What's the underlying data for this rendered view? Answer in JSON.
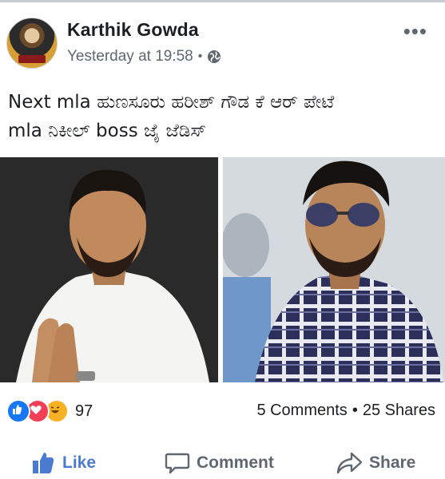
{
  "post": {
    "author": "Karthik Gowda",
    "timestamp": "Yesterday at 19:58",
    "separator": "•",
    "privacy_icon": "globe-icon",
    "more_label": "•••",
    "text_line1": "Next mla ಹುಣಸೂರು ಹರೀಶ್ ಗೌಡ   ಕೆ ಆರ್ ಪೇಟೆ",
    "text_line2": "mla ನಿಕೀಲ್ boss ಜೈ ಜೆಡಿಸ್"
  },
  "photos": [
    {
      "name": "photo-left",
      "icon": "person-photo"
    },
    {
      "name": "photo-right",
      "icon": "person-photo"
    }
  ],
  "reactions": {
    "types": [
      "like",
      "love",
      "haha"
    ],
    "count": "97",
    "comments": "5 Comments",
    "shares": "25 Shares",
    "separator": "•"
  },
  "actions": {
    "like_label": "Like",
    "comment_label": "Comment",
    "share_label": "Share"
  },
  "colors": {
    "like_blue": "#4a7bd0",
    "text_gray": "#606770",
    "love_red": "#f33e58",
    "haha_yellow": "#f7b125"
  }
}
